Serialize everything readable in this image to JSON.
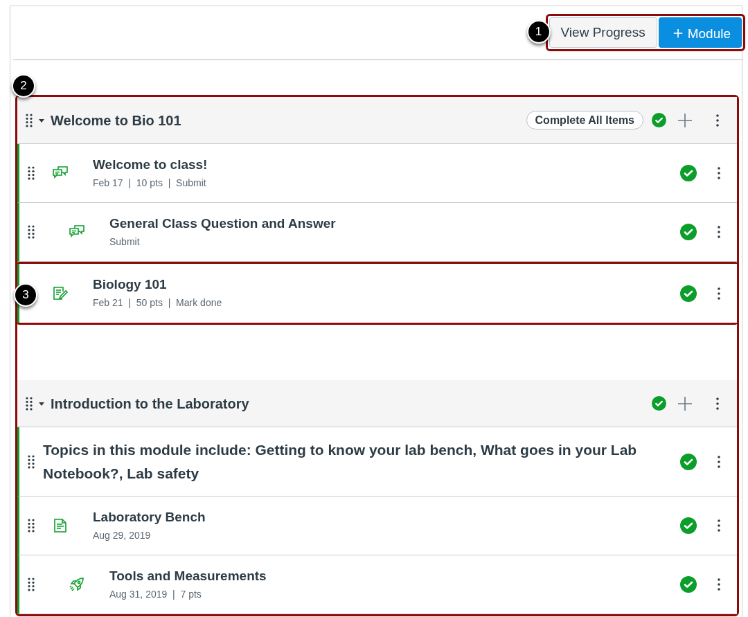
{
  "toolbar": {
    "callout": "1",
    "buttons": [
      {
        "kind": "secondary",
        "label": "View Progress"
      },
      {
        "kind": "primary",
        "icon": "＋",
        "label": "Module"
      }
    ]
  },
  "modules_callout": "2",
  "modules": [
    {
      "title": "Welcome to Bio 101",
      "expanded": true,
      "complete_all": "Complete All Items",
      "completed": true,
      "items": [
        {
          "kind": "discussion",
          "indented": false,
          "title": "Welcome to class!",
          "meta": "Feb 17  |  10 pts  |  Submit",
          "completed": true
        },
        {
          "kind": "discussion",
          "indented": true,
          "title": "General Class Question and Answer",
          "meta": "Submit",
          "completed": true
        },
        {
          "kind": "assignment",
          "indented": false,
          "title": "Biology 101",
          "meta": "Feb 21  |  50 pts  |  Mark done",
          "completed": true,
          "callout": "3"
        }
      ]
    },
    {
      "title": "Introduction to the Laboratory",
      "expanded": true,
      "completed": true,
      "items": [
        {
          "kind": "text",
          "title": "Topics in this module include: Getting to know your lab bench, What goes in your Lab Notebook?, Lab safety",
          "completed": true
        },
        {
          "kind": "page",
          "indented": false,
          "title": "Laboratory Bench",
          "meta": "Aug 29, 2019",
          "completed": true
        },
        {
          "kind": "quiz",
          "indented": true,
          "title": "Tools and Measurements",
          "meta": "Aug 31, 2019  |  7 pts",
          "completed": true
        }
      ]
    }
  ]
}
